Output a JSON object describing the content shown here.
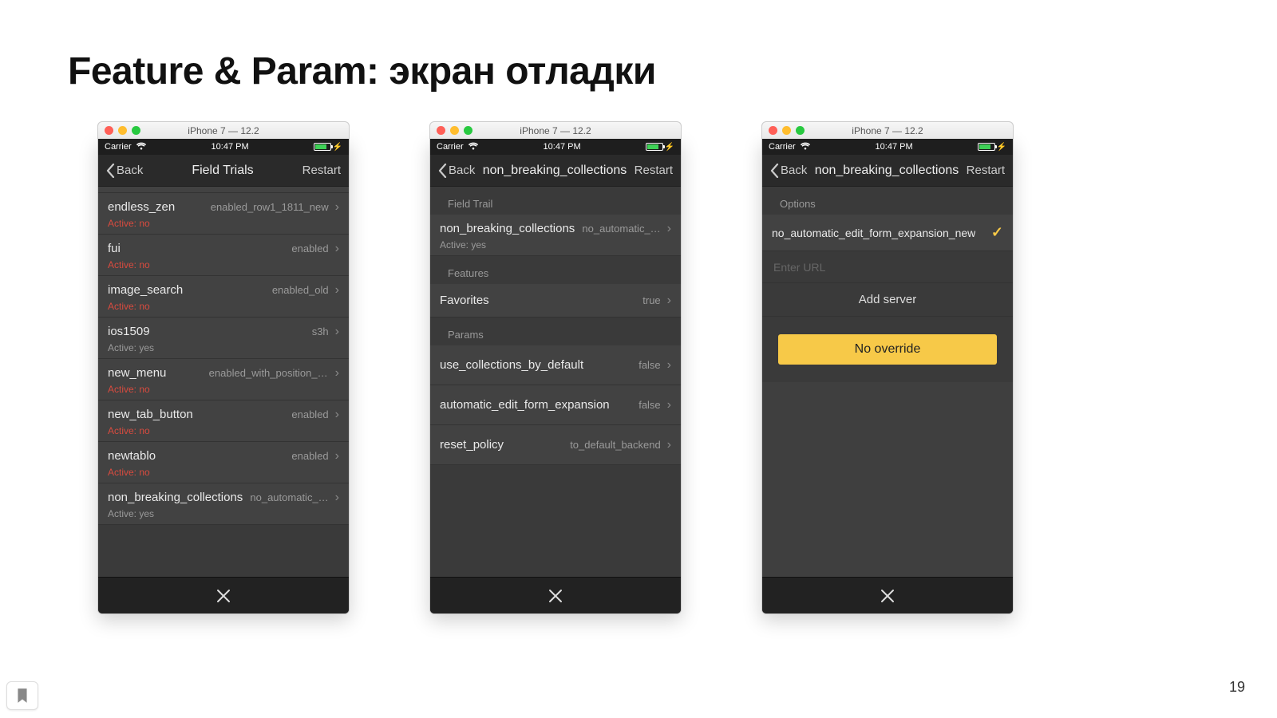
{
  "slide": {
    "title": "Feature & Param:  экран отладки",
    "page_number": "19"
  },
  "sim": {
    "window_title": "iPhone 7 — 12.2",
    "carrier": "Carrier",
    "time": "10:47 PM",
    "back_label": "Back",
    "restart_label": "Restart"
  },
  "screen1": {
    "nav_title": "Field Trials",
    "rows": [
      {
        "title": "endless_zen",
        "value": "enabled_row1_1811_new",
        "active": "no"
      },
      {
        "title": "fui",
        "value": "enabled",
        "active": "no"
      },
      {
        "title": "image_search",
        "value": "enabled_old",
        "active": "no"
      },
      {
        "title": "ios1509",
        "value": "s3h",
        "active": "yes"
      },
      {
        "title": "new_menu",
        "value": "enabled_with_position_old",
        "active": "no"
      },
      {
        "title": "new_tab_button",
        "value": "enabled",
        "active": "no"
      },
      {
        "title": "newtablo",
        "value": "enabled",
        "active": "no"
      },
      {
        "title": "non_breaking_collections",
        "value": "no_automatic_…",
        "active": "yes"
      }
    ],
    "active_prefix": "Active: "
  },
  "screen2": {
    "nav_title": "non_breaking_collections",
    "section_trail": "Field Trail",
    "trail_row": {
      "title": "non_breaking_collections",
      "value": "no_automatic_…",
      "active": "yes"
    },
    "section_features": "Features",
    "features": [
      {
        "title": "Favorites",
        "value": "true"
      }
    ],
    "section_params": "Params",
    "params": [
      {
        "title": "use_collections_by_default",
        "value": "false"
      },
      {
        "title": "automatic_edit_form_expansion",
        "value": "false"
      },
      {
        "title": "reset_policy",
        "value": "to_default_backend"
      }
    ],
    "active_prefix": "Active: "
  },
  "screen3": {
    "nav_title": "non_breaking_collections",
    "section_options": "Options",
    "option_label": "no_automatic_edit_form_expansion_new",
    "input_placeholder": "Enter URL",
    "add_server": "Add server",
    "no_override": "No override"
  }
}
